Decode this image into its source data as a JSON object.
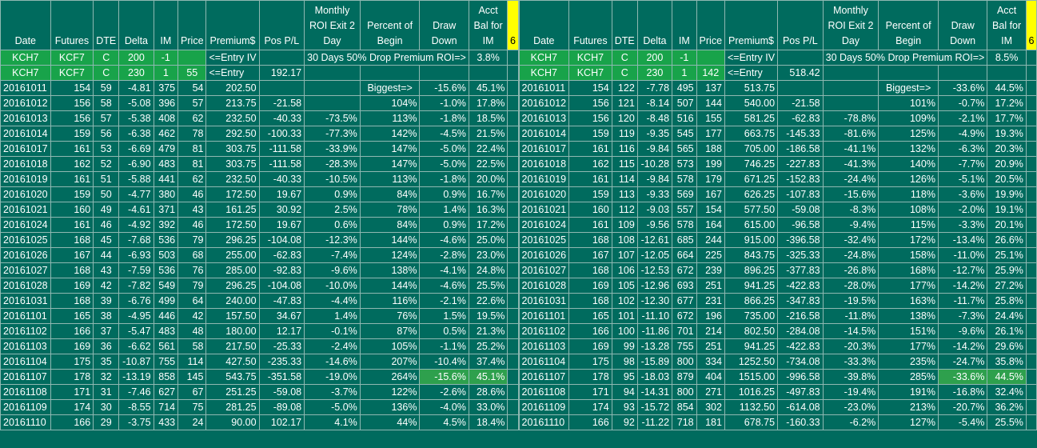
{
  "headers": [
    "Date",
    "Futures",
    "DTE",
    "Delta",
    "IM",
    "Price",
    "Premium$",
    "Pos P/L",
    "Monthly ROI Exit 2 Day",
    "Percent of Begin",
    "Draw Down",
    "Acct Bal for IM",
    "6"
  ],
  "panels": [
    {
      "setup": [
        [
          "KCH7",
          "KCF7",
          "C",
          "200",
          "-1",
          "",
          "<=Entry IV",
          "",
          "30 Days 50% Drop Premium ROI=>",
          "",
          "",
          "3.8%",
          ""
        ],
        [
          "KCH7",
          "KCF7",
          "C",
          "230",
          "1",
          "55",
          "<=Entry",
          "192.17",
          "",
          "",
          "",
          "",
          ""
        ]
      ],
      "rows": [
        [
          "20161011",
          "154",
          "59",
          "-4.81",
          "375",
          "54",
          "202.50",
          "",
          "",
          "Biggest=>",
          "-15.6%",
          "45.1%",
          ""
        ],
        [
          "20161012",
          "156",
          "58",
          "-5.08",
          "396",
          "57",
          "213.75",
          "-21.58",
          "",
          "104%",
          "-1.0%",
          "17.8%",
          ""
        ],
        [
          "20161013",
          "156",
          "57",
          "-5.38",
          "408",
          "62",
          "232.50",
          "-40.33",
          "-73.5%",
          "113%",
          "-1.8%",
          "18.5%",
          ""
        ],
        [
          "20161014",
          "159",
          "56",
          "-6.38",
          "462",
          "78",
          "292.50",
          "-100.33",
          "-77.3%",
          "142%",
          "-4.5%",
          "21.5%",
          ""
        ],
        [
          "20161017",
          "161",
          "53",
          "-6.69",
          "479",
          "81",
          "303.75",
          "-111.58",
          "-33.9%",
          "147%",
          "-5.0%",
          "22.4%",
          ""
        ],
        [
          "20161018",
          "162",
          "52",
          "-6.90",
          "483",
          "81",
          "303.75",
          "-111.58",
          "-28.3%",
          "147%",
          "-5.0%",
          "22.5%",
          ""
        ],
        [
          "20161019",
          "161",
          "51",
          "-5.88",
          "441",
          "62",
          "232.50",
          "-40.33",
          "-10.5%",
          "113%",
          "-1.8%",
          "20.0%",
          ""
        ],
        [
          "20161020",
          "159",
          "50",
          "-4.77",
          "380",
          "46",
          "172.50",
          "19.67",
          "0.9%",
          "84%",
          "0.9%",
          "16.7%",
          ""
        ],
        [
          "20161021",
          "160",
          "49",
          "-4.61",
          "371",
          "43",
          "161.25",
          "30.92",
          "2.5%",
          "78%",
          "1.4%",
          "16.3%",
          ""
        ],
        [
          "20161024",
          "161",
          "46",
          "-4.92",
          "392",
          "46",
          "172.50",
          "19.67",
          "0.6%",
          "84%",
          "0.9%",
          "17.2%",
          ""
        ],
        [
          "20161025",
          "168",
          "45",
          "-7.68",
          "536",
          "79",
          "296.25",
          "-104.08",
          "-12.3%",
          "144%",
          "-4.6%",
          "25.0%",
          ""
        ],
        [
          "20161026",
          "167",
          "44",
          "-6.93",
          "503",
          "68",
          "255.00",
          "-62.83",
          "-7.4%",
          "124%",
          "-2.8%",
          "23.0%",
          ""
        ],
        [
          "20161027",
          "168",
          "43",
          "-7.59",
          "536",
          "76",
          "285.00",
          "-92.83",
          "-9.6%",
          "138%",
          "-4.1%",
          "24.8%",
          ""
        ],
        [
          "20161028",
          "169",
          "42",
          "-7.82",
          "549",
          "79",
          "296.25",
          "-104.08",
          "-10.0%",
          "144%",
          "-4.6%",
          "25.5%",
          ""
        ],
        [
          "20161031",
          "168",
          "39",
          "-6.76",
          "499",
          "64",
          "240.00",
          "-47.83",
          "-4.4%",
          "116%",
          "-2.1%",
          "22.6%",
          ""
        ],
        [
          "20161101",
          "165",
          "38",
          "-4.95",
          "446",
          "42",
          "157.50",
          "34.67",
          "1.4%",
          "76%",
          "1.5%",
          "19.5%",
          ""
        ],
        [
          "20161102",
          "166",
          "37",
          "-5.47",
          "483",
          "48",
          "180.00",
          "12.17",
          "-0.1%",
          "87%",
          "0.5%",
          "21.3%",
          ""
        ],
        [
          "20161103",
          "169",
          "36",
          "-6.62",
          "561",
          "58",
          "217.50",
          "-25.33",
          "-2.4%",
          "105%",
          "-1.1%",
          "25.2%",
          ""
        ],
        [
          "20161104",
          "175",
          "35",
          "-10.87",
          "755",
          "114",
          "427.50",
          "-235.33",
          "-14.6%",
          "207%",
          "-10.4%",
          "37.4%",
          ""
        ],
        [
          "20161107",
          "178",
          "32",
          "-13.19",
          "858",
          "145",
          "543.75",
          "-351.58",
          "-19.0%",
          "264%",
          "-15.6%",
          "45.1%",
          ""
        ],
        [
          "20161108",
          "171",
          "31",
          "-7.46",
          "627",
          "67",
          "251.25",
          "-59.08",
          "-3.7%",
          "122%",
          "-2.6%",
          "28.6%",
          ""
        ],
        [
          "20161109",
          "174",
          "30",
          "-8.55",
          "714",
          "75",
          "281.25",
          "-89.08",
          "-5.0%",
          "136%",
          "-4.0%",
          "33.0%",
          ""
        ],
        [
          "20161110",
          "166",
          "29",
          "-3.75",
          "433",
          "24",
          "90.00",
          "102.17",
          "4.1%",
          "44%",
          "4.5%",
          "18.4%",
          ""
        ]
      ]
    },
    {
      "setup": [
        [
          "KCH7",
          "KCH7",
          "C",
          "200",
          "-1",
          "",
          "<=Entry IV",
          "",
          "30 Days 50% Drop Premium ROI=>",
          "",
          "",
          "8.5%",
          ""
        ],
        [
          "KCH7",
          "KCH7",
          "C",
          "230",
          "1",
          "142",
          "<=Entry",
          "518.42",
          "",
          "",
          "",
          "",
          ""
        ]
      ],
      "rows": [
        [
          "20161011",
          "154",
          "122",
          "-7.78",
          "495",
          "137",
          "513.75",
          "",
          "",
          "Biggest=>",
          "-33.6%",
          "44.5%",
          ""
        ],
        [
          "20161012",
          "156",
          "121",
          "-8.14",
          "507",
          "144",
          "540.00",
          "-21.58",
          "",
          "101%",
          "-0.7%",
          "17.2%",
          ""
        ],
        [
          "20161013",
          "156",
          "120",
          "-8.48",
          "516",
          "155",
          "581.25",
          "-62.83",
          "-78.8%",
          "109%",
          "-2.1%",
          "17.7%",
          ""
        ],
        [
          "20161014",
          "159",
          "119",
          "-9.35",
          "545",
          "177",
          "663.75",
          "-145.33",
          "-81.6%",
          "125%",
          "-4.9%",
          "19.3%",
          ""
        ],
        [
          "20161017",
          "161",
          "116",
          "-9.84",
          "565",
          "188",
          "705.00",
          "-186.58",
          "-41.1%",
          "132%",
          "-6.3%",
          "20.3%",
          ""
        ],
        [
          "20161018",
          "162",
          "115",
          "-10.28",
          "573",
          "199",
          "746.25",
          "-227.83",
          "-41.3%",
          "140%",
          "-7.7%",
          "20.9%",
          ""
        ],
        [
          "20161019",
          "161",
          "114",
          "-9.84",
          "578",
          "179",
          "671.25",
          "-152.83",
          "-24.4%",
          "126%",
          "-5.1%",
          "20.5%",
          ""
        ],
        [
          "20161020",
          "159",
          "113",
          "-9.33",
          "569",
          "167",
          "626.25",
          "-107.83",
          "-15.6%",
          "118%",
          "-3.6%",
          "19.9%",
          ""
        ],
        [
          "20161021",
          "160",
          "112",
          "-9.03",
          "557",
          "154",
          "577.50",
          "-59.08",
          "-8.3%",
          "108%",
          "-2.0%",
          "19.1%",
          ""
        ],
        [
          "20161024",
          "161",
          "109",
          "-9.56",
          "578",
          "164",
          "615.00",
          "-96.58",
          "-9.4%",
          "115%",
          "-3.3%",
          "20.1%",
          ""
        ],
        [
          "20161025",
          "168",
          "108",
          "-12.61",
          "685",
          "244",
          "915.00",
          "-396.58",
          "-32.4%",
          "172%",
          "-13.4%",
          "26.6%",
          ""
        ],
        [
          "20161026",
          "167",
          "107",
          "-12.05",
          "664",
          "225",
          "843.75",
          "-325.33",
          "-24.8%",
          "158%",
          "-11.0%",
          "25.1%",
          ""
        ],
        [
          "20161027",
          "168",
          "106",
          "-12.53",
          "672",
          "239",
          "896.25",
          "-377.83",
          "-26.8%",
          "168%",
          "-12.7%",
          "25.9%",
          ""
        ],
        [
          "20161028",
          "169",
          "105",
          "-12.96",
          "693",
          "251",
          "941.25",
          "-422.83",
          "-28.0%",
          "177%",
          "-14.2%",
          "27.2%",
          ""
        ],
        [
          "20161031",
          "168",
          "102",
          "-12.30",
          "677",
          "231",
          "866.25",
          "-347.83",
          "-19.5%",
          "163%",
          "-11.7%",
          "25.8%",
          ""
        ],
        [
          "20161101",
          "165",
          "101",
          "-11.10",
          "672",
          "196",
          "735.00",
          "-216.58",
          "-11.8%",
          "138%",
          "-7.3%",
          "24.4%",
          ""
        ],
        [
          "20161102",
          "166",
          "100",
          "-11.86",
          "701",
          "214",
          "802.50",
          "-284.08",
          "-14.5%",
          "151%",
          "-9.6%",
          "26.1%",
          ""
        ],
        [
          "20161103",
          "169",
          "99",
          "-13.28",
          "755",
          "251",
          "941.25",
          "-422.83",
          "-20.3%",
          "177%",
          "-14.2%",
          "29.6%",
          ""
        ],
        [
          "20161104",
          "175",
          "98",
          "-15.89",
          "800",
          "334",
          "1252.50",
          "-734.08",
          "-33.3%",
          "235%",
          "-24.7%",
          "35.8%",
          ""
        ],
        [
          "20161107",
          "178",
          "95",
          "-18.03",
          "879",
          "404",
          "1515.00",
          "-996.58",
          "-39.8%",
          "285%",
          "-33.6%",
          "44.5%",
          ""
        ],
        [
          "20161108",
          "171",
          "94",
          "-14.31",
          "800",
          "271",
          "1016.25",
          "-497.83",
          "-19.4%",
          "191%",
          "-16.8%",
          "32.4%",
          ""
        ],
        [
          "20161109",
          "174",
          "93",
          "-15.72",
          "854",
          "302",
          "1132.50",
          "-614.08",
          "-23.0%",
          "213%",
          "-20.7%",
          "36.2%",
          ""
        ],
        [
          "20161110",
          "166",
          "92",
          "-11.22",
          "718",
          "181",
          "678.75",
          "-160.33",
          "-6.2%",
          "127%",
          "-5.4%",
          "25.5%",
          ""
        ]
      ]
    }
  ],
  "highlight_row_index": 19,
  "colors": {
    "background": "#006b5e",
    "setup_green": "#18a34a",
    "highlight_green": "#2ea04d",
    "header_marker": "#ffff00"
  }
}
